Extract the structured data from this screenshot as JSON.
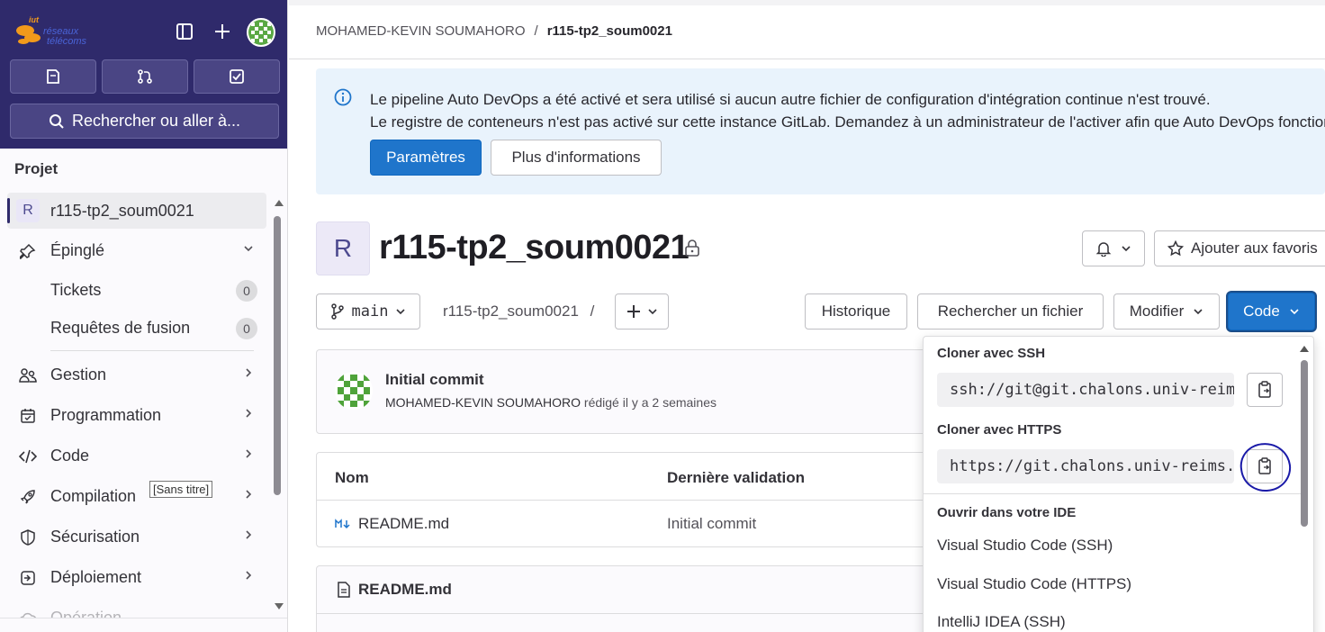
{
  "sidebar": {
    "logo_text": "iut réseaux télécoms",
    "search_label": "Rechercher ou aller à...",
    "section_title": "Projet",
    "project_initial": "R",
    "project_name": "r115-tp2_soum0021",
    "pinned_label": "Épinglé",
    "sub_items": [
      {
        "label": "Tickets",
        "count": "0"
      },
      {
        "label": "Requêtes de fusion",
        "count": "0"
      }
    ],
    "nav_items": [
      {
        "label": "Gestion",
        "icon": "users-icon"
      },
      {
        "label": "Programmation",
        "icon": "calendar-icon"
      },
      {
        "label": "Code",
        "icon": "code-icon"
      },
      {
        "label": "Compilation",
        "icon": "rocket-icon"
      },
      {
        "label": "Sécurisation",
        "icon": "shield-icon"
      },
      {
        "label": "Déploiement",
        "icon": "deploy-icon"
      },
      {
        "label": "Opération",
        "icon": "cloud-icon"
      }
    ],
    "tooltip": "[Sans titre]"
  },
  "breadcrumb": {
    "owner": "MOHAMED-KEVIN SOUMAHORO",
    "separator": "/",
    "project": "r115-tp2_soum0021"
  },
  "alert": {
    "line1": "Le pipeline Auto DevOps a été activé et sera utilisé si aucun autre fichier de configuration d'intégration continue n'est trouvé.",
    "line2": "Le registre de conteneurs n'est pas activé sur cette instance GitLab. Demandez à un administrateur de l'activer afin que Auto DevOps fonctionne.",
    "primary_button": "Paramètres",
    "secondary_button": "Plus d'informations"
  },
  "project": {
    "initial": "R",
    "title": "r115-tp2_soum0021",
    "star_button": "Ajouter aux favoris"
  },
  "repo_toolbar": {
    "branch": "main",
    "path": "r115-tp2_soum0021",
    "path_sep": "/",
    "history_button": "Historique",
    "find_file_button": "Rechercher un fichier",
    "edit_button": "Modifier",
    "code_button": "Code"
  },
  "commit": {
    "title": "Initial commit",
    "author": "MOHAMED-KEVIN SOUMAHORO",
    "meta": "rédigé il y a 2 semaines"
  },
  "files_table": {
    "headers": [
      "Nom",
      "Dernière validation"
    ],
    "rows": [
      {
        "name": "README.md",
        "last_commit": "Initial commit"
      }
    ]
  },
  "readme": {
    "title": "README.md"
  },
  "clone_dropdown": {
    "ssh_label": "Cloner avec SSH",
    "ssh_url": "ssh://git@git.chalons.univ-reims.fr",
    "https_label": "Cloner avec HTTPS",
    "https_url": "https://git.chalons.univ-reims.fr",
    "ide_label": "Ouvrir dans votre IDE",
    "ide_items": [
      "Visual Studio Code (SSH)",
      "Visual Studio Code (HTTPS)",
      "IntelliJ IDEA (SSH)"
    ]
  },
  "colors": {
    "sidebar_top": "#2f2a6b",
    "primary": "#1f75cb",
    "alert_bg": "#e9f3fc",
    "annotation": "#1a1aa8"
  }
}
